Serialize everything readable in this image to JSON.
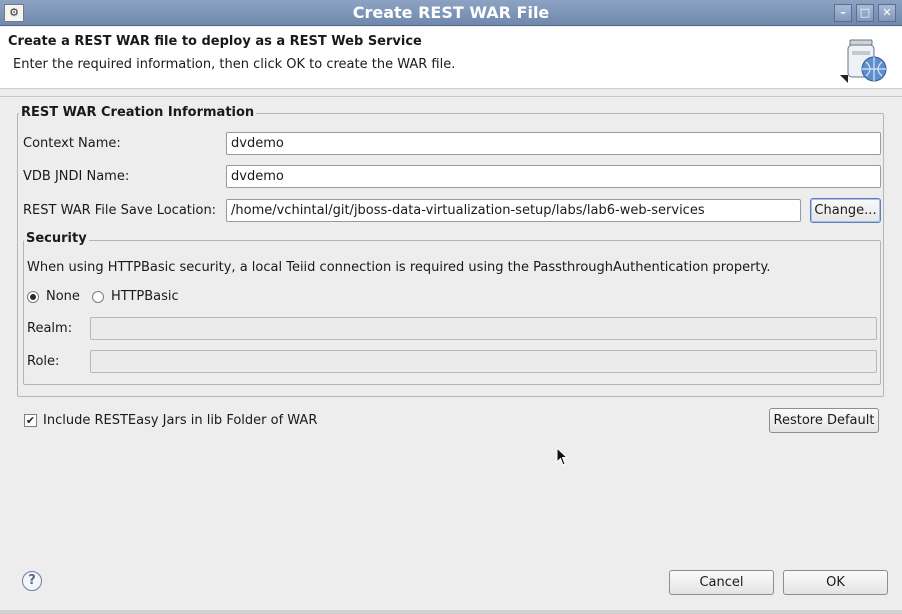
{
  "window": {
    "title": "Create REST WAR File",
    "app_icon": "app-icon",
    "controls": {
      "minimize": "–",
      "maximize": "□",
      "close": "✕"
    }
  },
  "header": {
    "title": "Create a REST WAR file to deploy as a REST Web Service",
    "description": "Enter the required information, then click OK to create the WAR file.",
    "icon": "rest-war-wizard-icon"
  },
  "info_group": {
    "title": "REST WAR Creation Information",
    "context_name": {
      "label": "Context Name:",
      "value": "dvdemo"
    },
    "vdb_jndi_name": {
      "label": "VDB JNDI Name:",
      "value": "dvdemo"
    },
    "save_location": {
      "label": "REST WAR File Save Location:",
      "value": "/home/vchintal/git/jboss-data-virtualization-setup/labs/lab6-web-services",
      "change_button": "Change..."
    }
  },
  "security": {
    "title": "Security",
    "note": "When using HTTPBasic security, a local Teiid connection is required using the PassthroughAuthentication property.",
    "options": [
      {
        "label": "None",
        "selected": true
      },
      {
        "label": "HTTPBasic",
        "selected": false
      }
    ],
    "realm": {
      "label": "Realm:",
      "value": ""
    },
    "role": {
      "label": "Role:",
      "value": ""
    }
  },
  "resteasy": {
    "label": "Include RESTEasy Jars in lib Folder of WAR",
    "checked": true,
    "restore_button": "Restore Default"
  },
  "footer": {
    "help_icon": "?",
    "cancel_label": "Cancel",
    "ok_label": "OK"
  }
}
